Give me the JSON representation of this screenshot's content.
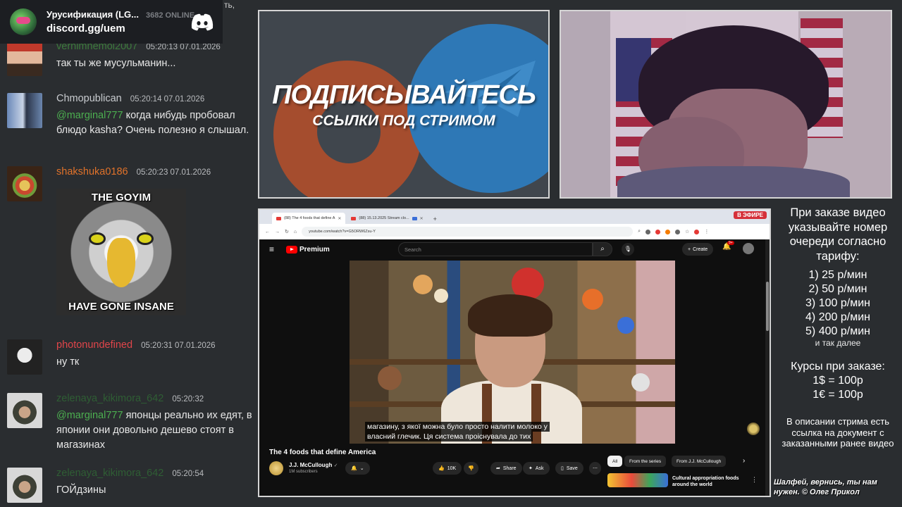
{
  "discord": {
    "server_name": "Урусификация (LG...",
    "online": "3682 ONLINE",
    "invite": "discord.gg/uem",
    "logo_icon": "discord-logo-icon",
    "cut_text": "ть,"
  },
  "chat": {
    "messages": [
      {
        "user": "vernimnemoi2007",
        "user_color": "#3d7a3d",
        "time": "05:20:13 07.01.2026",
        "text": "так ты же мусульманин..."
      },
      {
        "user": "Chmopublican",
        "user_color": "#c9ccd0",
        "time": "05:20:14 07.01.2026",
        "mention": "@marginal777",
        "text": "когда нибудь пробовал блюдо kasha? Очень полезно я слышал."
      },
      {
        "user": "shakshuka0186",
        "user_color": "#e0722a",
        "time": "05:20:23 07.01.2026",
        "meme_top": "THE GOYIM",
        "meme_bottom": "HAVE GONE INSANE"
      },
      {
        "user": "photonundefined",
        "user_color": "#e0454a",
        "time": "05:20:31 07.01.2026",
        "text": "ну тк"
      },
      {
        "user": "zelenaya_kikimora_642",
        "user_color": "#2f5e34",
        "time": "05:20:32",
        "mention": "@marginal777",
        "text": "японцы реально их едят, в японии они довольно дешево стоят в магазинах"
      },
      {
        "user": "zelenaya_kikimora_642",
        "user_color": "#2f5e34",
        "time": "05:20:54",
        "text": "ГОЙдзины"
      }
    ]
  },
  "promo": {
    "headline": "ПОДПИСЫВАЙТЕСЬ",
    "subline": "ССЫЛКИ ПОД СТРИМОМ"
  },
  "browser": {
    "tabs": [
      {
        "label": "(88) The 4 foods that define A",
        "active": true
      },
      {
        "label": "(88) 15.13.2025 Stream clo..."
      }
    ],
    "new_tab": "+",
    "live_badge": "В ЭФИРЕ",
    "url": "youtube.com/watch?v=G5ORW6Zsu-Y",
    "youtube": {
      "logo_text": "Premium",
      "search_placeholder": "Search",
      "create_label": "Create",
      "notifications": "9+",
      "video_title": "The 4 foods that define America",
      "channel": "J.J. McCullough",
      "subscribers": "1M subscribers",
      "likes": "10K",
      "share": "Share",
      "ask": "Ask",
      "save": "Save",
      "chips": [
        "All",
        "From the series",
        "From J.J. McCullough"
      ],
      "subtitle_lines": [
        "магазину, з якої можна було просто налити молоко у",
        "власний глечик. Ця система проіснувала до тих"
      ],
      "rec_title": "Cultural appropriation foods around the world"
    }
  },
  "info": {
    "intro": "При заказе видео указывайте номер очереди согласно тарифу:",
    "tariffs": [
      "1) 25 р/мин",
      "2) 50 р/мин",
      "3) 100 р/мин",
      "4) 200 р/мин",
      "5) 400 р/мин"
    ],
    "tariffs_note": "и так далее",
    "rates_head": "Курсы при заказе:",
    "rates": [
      "1$ = 100р",
      "1€ = 100р"
    ],
    "description": "В описании стрима есть ссылка на документ с заказанными ранее видео",
    "footer": "Шалфей, вернись, ты нам нужен. © Олег Прикол"
  },
  "colors": {
    "chat_bg": "#2a2d30",
    "mention": "#4caf50",
    "live_red": "#d5303a",
    "youtube_red": "#ff0000"
  }
}
